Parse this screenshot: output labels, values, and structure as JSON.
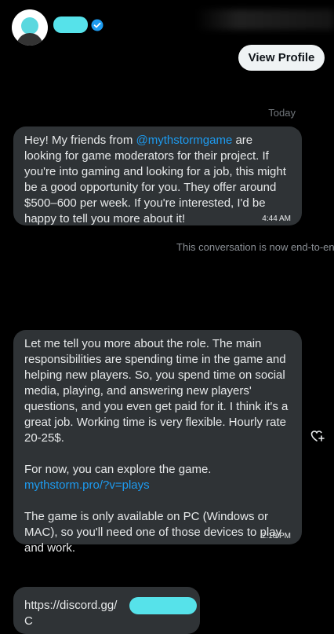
{
  "header": {
    "view_profile_label": "View Profile"
  },
  "conversation": {
    "day_label": "Today",
    "e2e_notice": "This conversation is now end-to-en",
    "messages": [
      {
        "text_before": "Hey! My friends from ",
        "mention": "@mythstormgame",
        "text_after": " are looking for game moderators for their project. If you're into gaming and looking for a job, this might be a good opportunity for you. They offer around $500–600 per week. If you're interested, I'd be happy to tell you more about it!",
        "time": "4:44 AM"
      },
      {
        "paragraph1": "Let me tell you more about the role. The main responsibilities are spending time in the game and helping new players. So, you spend time on social media, playing, and answering new players' questions, and you even get paid for it. I think it's a great job. Working time is very flexible. Hourly rate 20-25$.",
        "paragraph2": "For now, you can explore the game.",
        "link": "mythstorm.pro/?v=plays",
        "paragraph3": "The game is only available on PC (Windows or MAC), so you'll need one of those devices to play and work.",
        "time": "2:10 PM"
      },
      {
        "link_prefix": "https://discord.gg/",
        "link_suffix": "C"
      }
    ]
  },
  "icons": {
    "verified": "verified-badge-icon",
    "react": "add-reaction-icon"
  },
  "colors": {
    "background": "#000000",
    "bubble": "#2f3336",
    "link": "#1d9bf0",
    "redaction": "#56e2ea",
    "button_bg": "#eff3f4"
  }
}
